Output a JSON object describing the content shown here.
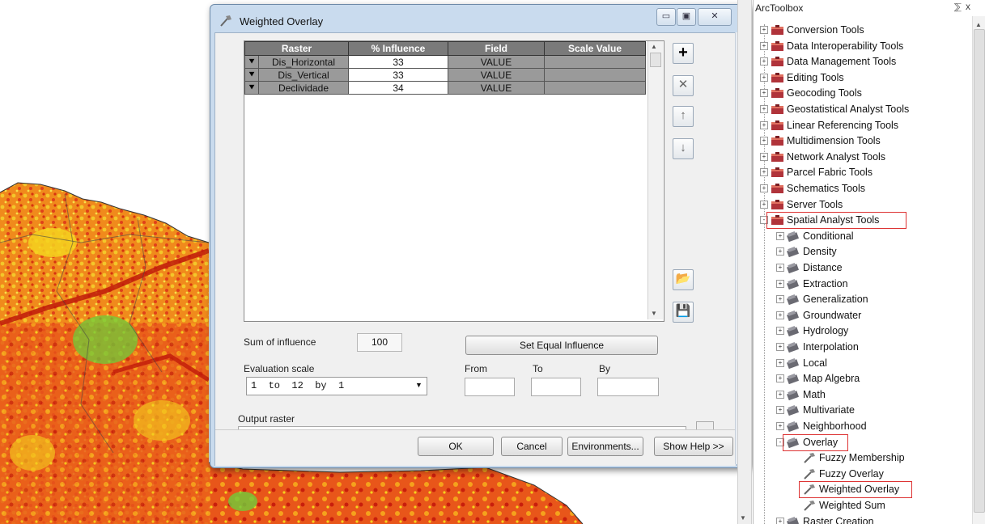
{
  "dialog": {
    "title": "Weighted Overlay",
    "window_buttons": [
      "minimize",
      "maximize",
      "close"
    ],
    "table": {
      "columns": [
        "Raster",
        "% Influence",
        "Field",
        "Scale Value"
      ],
      "rows": [
        {
          "raster": "Dis_Horizontal",
          "influence": "33",
          "field": "VALUE",
          "scale": ""
        },
        {
          "raster": "Dis_Vertical",
          "influence": "33",
          "field": "VALUE",
          "scale": ""
        },
        {
          "raster": "Declividade",
          "influence": "34",
          "field": "VALUE",
          "scale": ""
        }
      ]
    },
    "side_buttons": [
      "add-icon",
      "remove-icon",
      "move-up-icon",
      "move-down-icon",
      "open-folder-icon",
      "save-icon"
    ],
    "sum_label": "Sum of influence",
    "sum_value": "100",
    "set_equal_label": "Set Equal Influence",
    "eval_label": "Evaluation scale",
    "eval_value": "1  to  12  by  1",
    "from_label": "From",
    "to_label": "To",
    "by_label": "By",
    "output_label": "Output raster",
    "ok_label": "OK",
    "cancel_label": "Cancel",
    "env_label": "Environments...",
    "help_label": "Show Help >>"
  },
  "toolbox": {
    "title": "ArcToolbox",
    "pin": "⅀ x",
    "items": [
      {
        "label": "Conversion Tools",
        "level": 0,
        "expander": "+"
      },
      {
        "label": "Data Interoperability Tools",
        "level": 0,
        "expander": "+"
      },
      {
        "label": "Data Management Tools",
        "level": 0,
        "expander": "+"
      },
      {
        "label": "Editing Tools",
        "level": 0,
        "expander": "+"
      },
      {
        "label": "Geocoding Tools",
        "level": 0,
        "expander": "+"
      },
      {
        "label": "Geostatistical Analyst Tools",
        "level": 0,
        "expander": "+"
      },
      {
        "label": "Linear Referencing Tools",
        "level": 0,
        "expander": "+"
      },
      {
        "label": "Multidimension Tools",
        "level": 0,
        "expander": "+"
      },
      {
        "label": "Network Analyst Tools",
        "level": 0,
        "expander": "+"
      },
      {
        "label": "Parcel Fabric Tools",
        "level": 0,
        "expander": "+"
      },
      {
        "label": "Schematics Tools",
        "level": 0,
        "expander": "+"
      },
      {
        "label": "Server Tools",
        "level": 0,
        "expander": "+"
      },
      {
        "label": "Spatial Analyst Tools",
        "level": 0,
        "expander": "-",
        "highlight": true
      },
      {
        "label": "Conditional",
        "level": 1,
        "expander": "+"
      },
      {
        "label": "Density",
        "level": 1,
        "expander": "+"
      },
      {
        "label": "Distance",
        "level": 1,
        "expander": "+"
      },
      {
        "label": "Extraction",
        "level": 1,
        "expander": "+"
      },
      {
        "label": "Generalization",
        "level": 1,
        "expander": "+"
      },
      {
        "label": "Groundwater",
        "level": 1,
        "expander": "+"
      },
      {
        "label": "Hydrology",
        "level": 1,
        "expander": "+"
      },
      {
        "label": "Interpolation",
        "level": 1,
        "expander": "+"
      },
      {
        "label": "Local",
        "level": 1,
        "expander": "+"
      },
      {
        "label": "Map Algebra",
        "level": 1,
        "expander": "+"
      },
      {
        "label": "Math",
        "level": 1,
        "expander": "+"
      },
      {
        "label": "Multivariate",
        "level": 1,
        "expander": "+"
      },
      {
        "label": "Neighborhood",
        "level": 1,
        "expander": "+"
      },
      {
        "label": "Overlay",
        "level": 1,
        "expander": "-",
        "highlight": true
      },
      {
        "label": "Fuzzy Membership",
        "level": 2,
        "expander": ""
      },
      {
        "label": "Fuzzy Overlay",
        "level": 2,
        "expander": ""
      },
      {
        "label": "Weighted Overlay",
        "level": 2,
        "expander": "",
        "highlight": true
      },
      {
        "label": "Weighted Sum",
        "level": 2,
        "expander": ""
      },
      {
        "label": "Raster Creation",
        "level": 1,
        "expander": "+"
      }
    ]
  },
  "colors": {
    "map_red": "#d42a10",
    "map_orange": "#f07a12",
    "map_yellow": "#f4d21e",
    "map_green": "#7fdc3c",
    "highlight_red": "#dd3333",
    "dialog_frame": "#c9dbee"
  }
}
